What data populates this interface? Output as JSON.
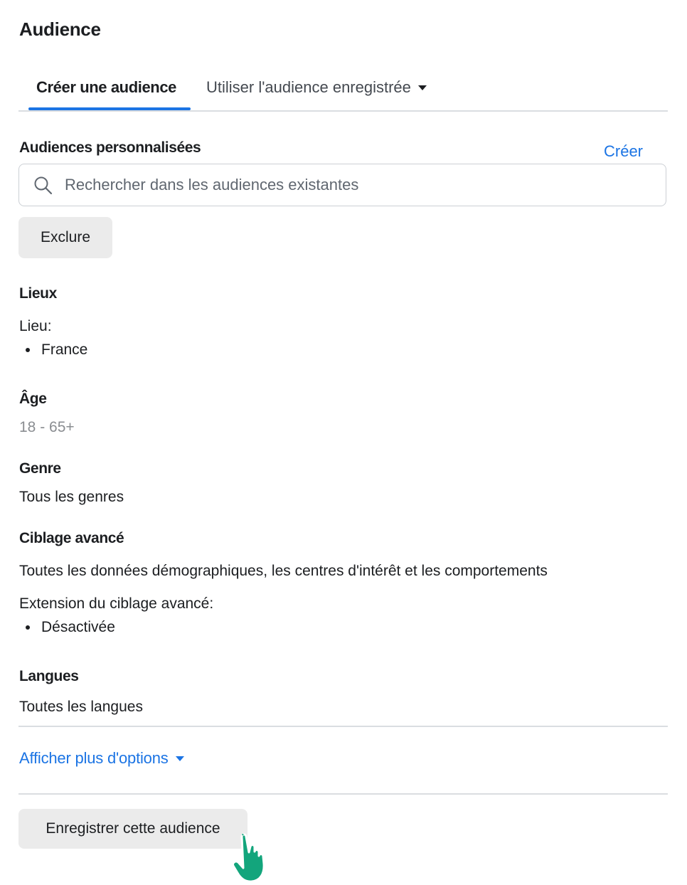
{
  "page": {
    "title": "Audience"
  },
  "tabs": [
    {
      "label": "Créer une audience",
      "active": true
    },
    {
      "label": "Utiliser l'audience enregistrée",
      "active": false,
      "icon": "caret-down-icon"
    }
  ],
  "custom_audiences": {
    "label": "Audiences personnalisées",
    "create_link": "Créer",
    "search": {
      "placeholder": "Rechercher dans les audiences existantes",
      "value": "",
      "icon": "search-icon"
    },
    "exclude_button": "Exclure"
  },
  "locations": {
    "heading": "Lieux",
    "sublabel": "Lieu:",
    "items": [
      "France"
    ]
  },
  "age": {
    "heading": "Âge",
    "value": "18 - 65+"
  },
  "gender": {
    "heading": "Genre",
    "value": "Tous les genres"
  },
  "detailed_targeting": {
    "heading": "Ciblage avancé",
    "value": "Toutes les données démographiques, les centres d'intérêt et les comportements",
    "expansion_label": "Extension du ciblage avancé:",
    "expansion_items": [
      "Désactivée"
    ]
  },
  "languages": {
    "heading": "Langues",
    "value": "Toutes les langues"
  },
  "more_options": {
    "label": "Afficher plus d'options",
    "icon": "caret-down-icon"
  },
  "save_button": {
    "label": "Enregistrer cette audience"
  },
  "colors": {
    "accent": "#1b74e4",
    "text": "#1c1e21",
    "muted": "#8a8d91",
    "button_bg": "#ebebeb",
    "divider": "#dadde1",
    "cursor_green": "#13a57c"
  }
}
